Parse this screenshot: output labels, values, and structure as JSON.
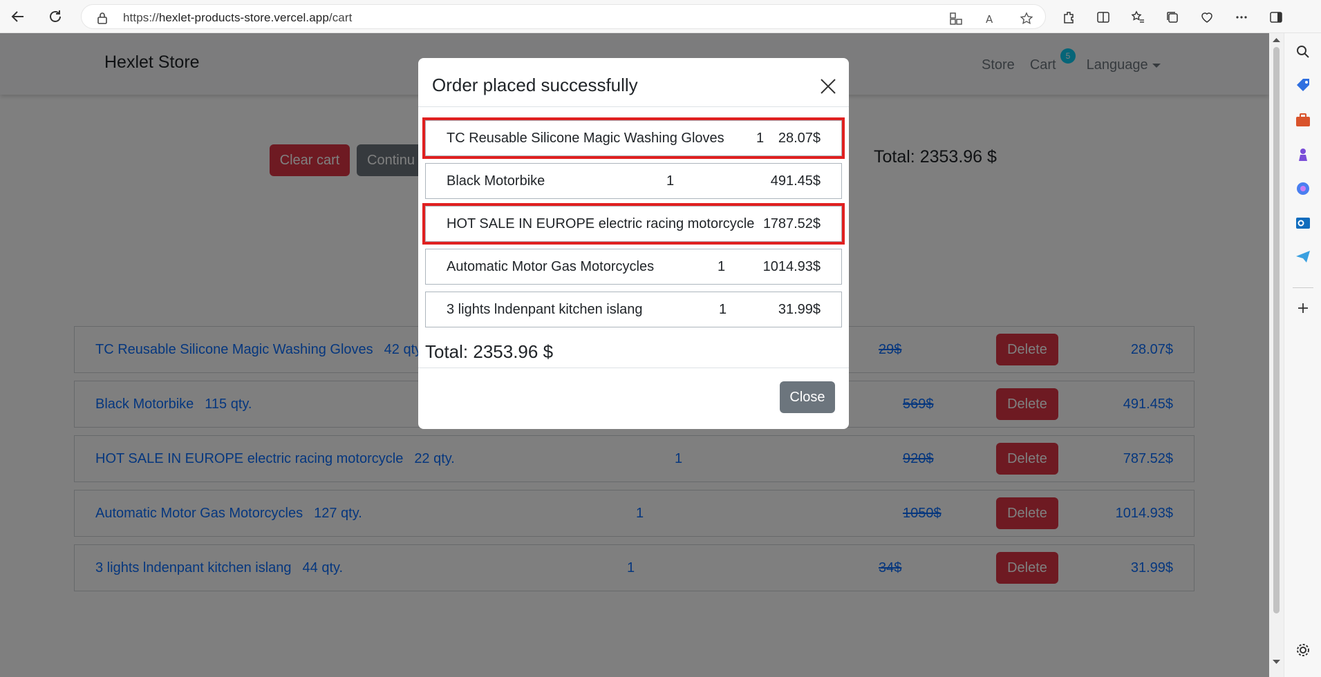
{
  "browser": {
    "url_prefix": "https://",
    "url_host": "hexlet-products-store.vercel.app",
    "url_path": "/cart"
  },
  "navbar": {
    "brand": "Hexlet Store",
    "store": "Store",
    "cart": "Cart",
    "cart_count": "5",
    "language": "Language"
  },
  "cart_page": {
    "clear_cart": "Clear cart",
    "continue": "Continu",
    "total": "Total: 2353.96 $",
    "delete_label": "Delete",
    "rows": [
      {
        "name": "TC Reusable Silicone Magic Washing Gloves",
        "stock": "42 qty.",
        "count": "",
        "old_price": "29$",
        "price": "28.07$"
      },
      {
        "name": "Black Motorbike",
        "stock": "115 qty.",
        "count": "",
        "old_price": "569$",
        "price": "491.45$"
      },
      {
        "name": "HOT SALE IN EUROPE electric racing motorcycle",
        "stock": "22 qty.",
        "count": "1",
        "old_price": "920$",
        "price": "787.52$"
      },
      {
        "name": "Automatic Motor Gas Motorcycles",
        "stock": "127 qty.",
        "count": "1",
        "old_price": "1050$",
        "price": "1014.93$"
      },
      {
        "name": "3 lights lndenpant kitchen islang",
        "stock": "44 qty.",
        "count": "1",
        "old_price": "34$",
        "price": "31.99$"
      }
    ]
  },
  "modal": {
    "title": "Order placed successfully",
    "items": [
      {
        "name": "TC Reusable Silicone Magic Washing Gloves",
        "qty": "1",
        "price": "28.07$"
      },
      {
        "name": "Black Motorbike",
        "qty": "1",
        "price": "491.45$"
      },
      {
        "name": "HOT SALE IN EUROPE electric racing motorcycle",
        "qty": "1",
        "price": "787.52$"
      },
      {
        "name": "Automatic Motor Gas Motorcycles",
        "qty": "1",
        "price": "1014.93$"
      },
      {
        "name": "3 lights lndenpant kitchen islang",
        "qty": "1",
        "price": "31.99$"
      }
    ],
    "total": "Total: 2353.96 $",
    "close_button": "Close"
  },
  "colors": {
    "highlight": "#e02020",
    "danger": "#dc3545",
    "secondary": "#6c757d",
    "link": "#0d6efd",
    "badge": "#0dcaf0"
  },
  "icons": {
    "back": "back-arrow-icon",
    "refresh": "refresh-icon",
    "lock": "lock-icon",
    "close": "close-icon"
  }
}
